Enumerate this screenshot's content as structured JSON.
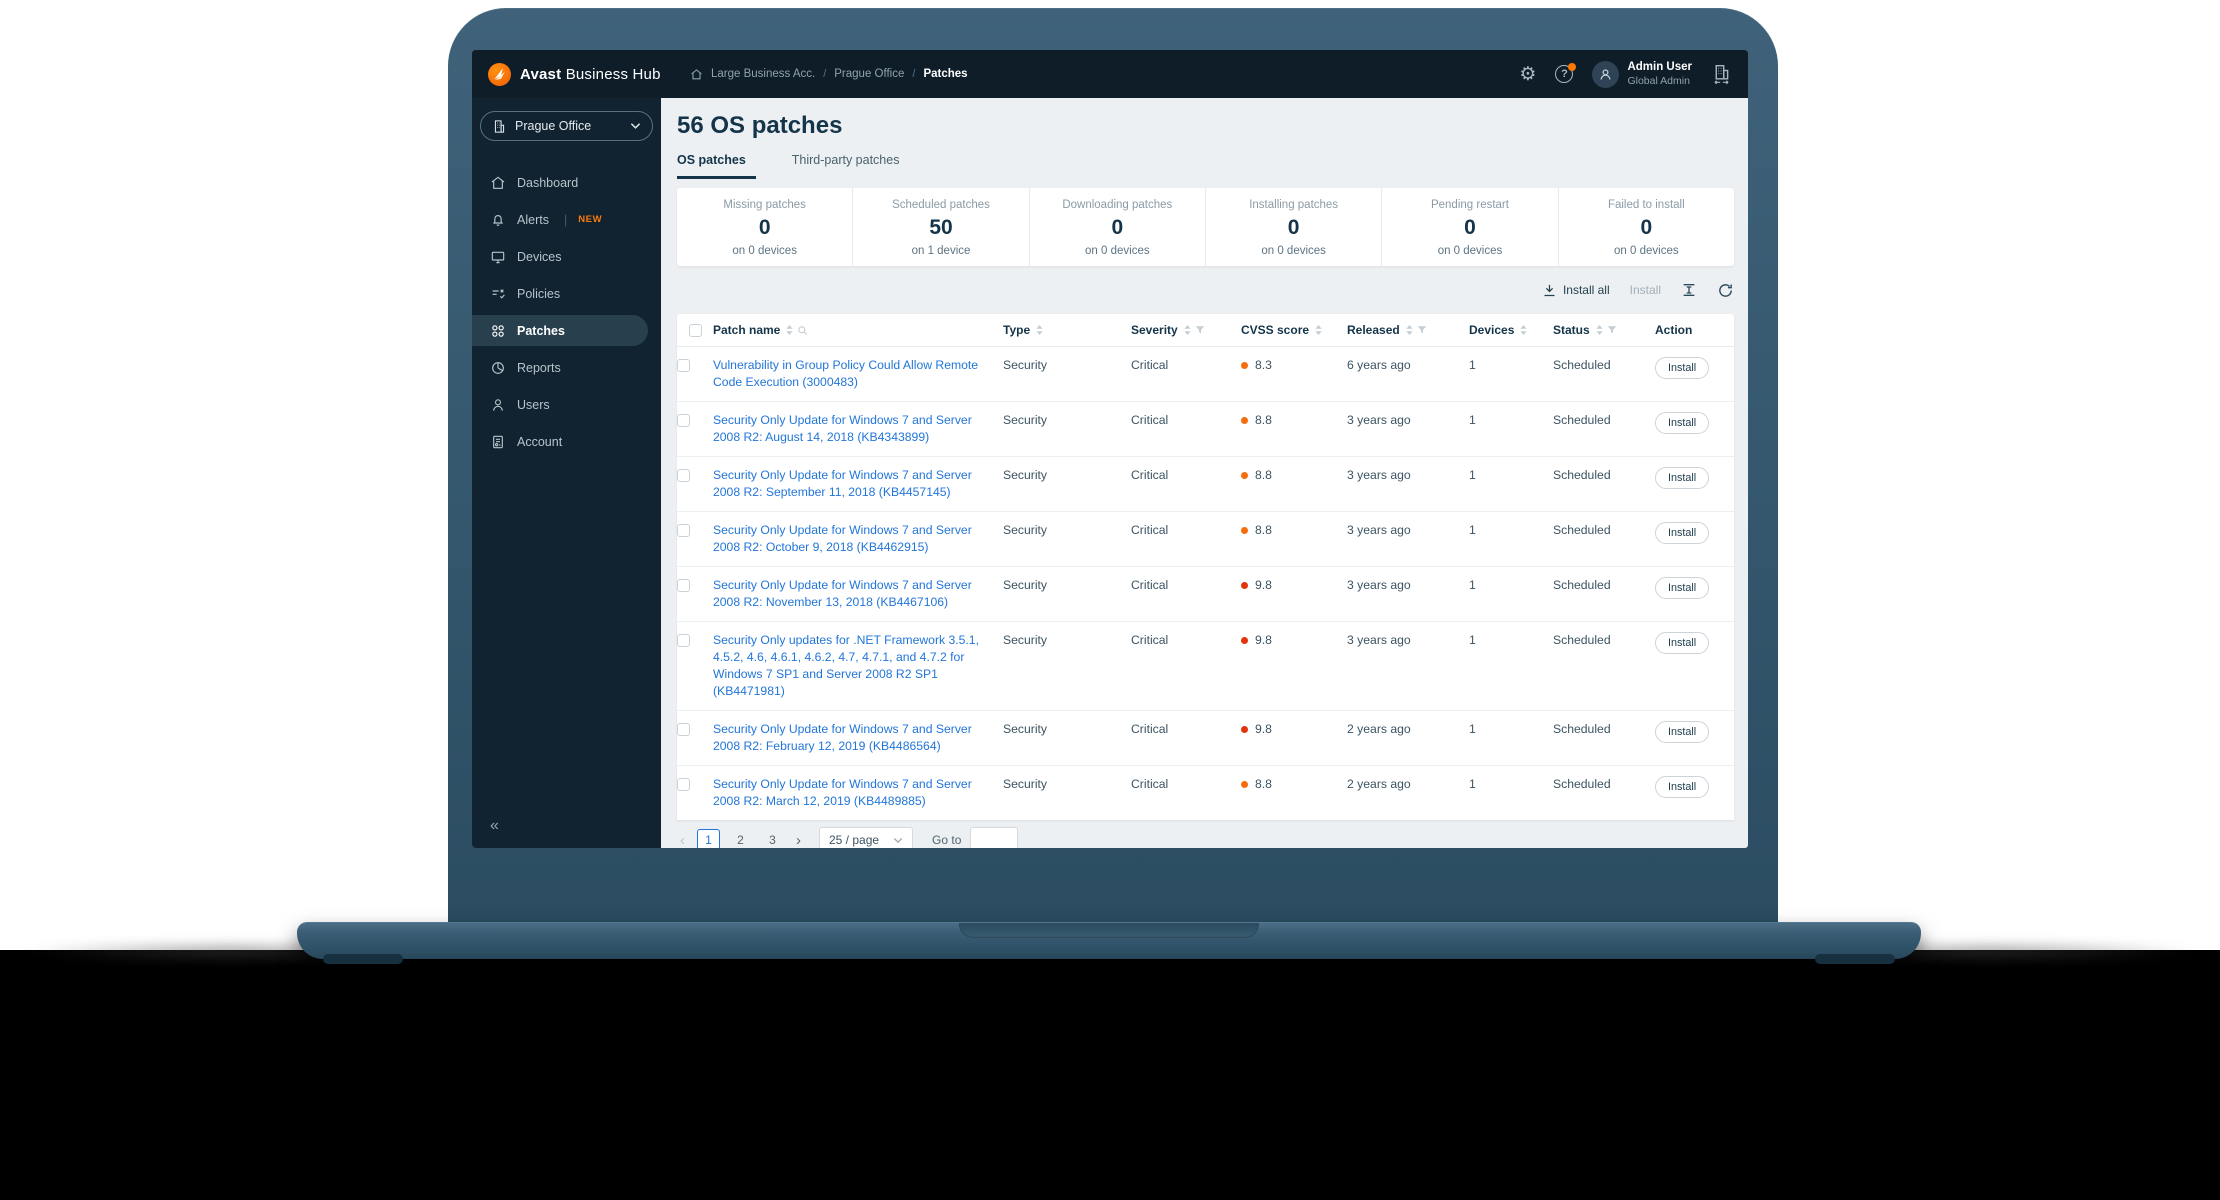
{
  "topbar": {
    "brand_bold": "Avast",
    "brand_rest": "Business Hub",
    "breadcrumb": [
      "Large Business Acc.",
      "Prague Office",
      "Patches"
    ],
    "user": {
      "name": "Admin User",
      "role": "Global Admin"
    }
  },
  "sidebar": {
    "org_selector": "Prague Office",
    "items": [
      {
        "label": "Dashboard"
      },
      {
        "label": "Alerts",
        "badge": "NEW"
      },
      {
        "label": "Devices"
      },
      {
        "label": "Policies"
      },
      {
        "label": "Patches",
        "active": true
      },
      {
        "label": "Reports"
      },
      {
        "label": "Users"
      },
      {
        "label": "Account"
      }
    ]
  },
  "icons": {
    "gear": "⚙",
    "help": "?",
    "collapse": "«",
    "prev": "‹",
    "next": "›"
  },
  "main": {
    "title": "56 OS patches",
    "tabs": [
      {
        "label": "OS patches",
        "active": true
      },
      {
        "label": "Third-party patches",
        "active": false
      }
    ],
    "stats": [
      {
        "label": "Missing patches",
        "value": "0",
        "sub": "on 0 devices"
      },
      {
        "label": "Scheduled patches",
        "value": "50",
        "sub": "on 1 device"
      },
      {
        "label": "Downloading patches",
        "value": "0",
        "sub": "on 0 devices"
      },
      {
        "label": "Installing patches",
        "value": "0",
        "sub": "on 0 devices"
      },
      {
        "label": "Pending restart",
        "value": "0",
        "sub": "on 0 devices"
      },
      {
        "label": "Failed to install",
        "value": "0",
        "sub": "on 0 devices"
      }
    ],
    "toolbar": {
      "install_all": "Install all",
      "install": "Install"
    },
    "table": {
      "columns": [
        {
          "label": "Patch name"
        },
        {
          "label": "Type"
        },
        {
          "label": "Severity"
        },
        {
          "label": "CVSS score"
        },
        {
          "label": "Released"
        },
        {
          "label": "Devices"
        },
        {
          "label": "Status"
        },
        {
          "label": "Action"
        }
      ],
      "rows": [
        {
          "name": "Vulnerability in Group Policy Could Allow Remote Code Execution (3000483)",
          "type": "Security",
          "severity": "Critical",
          "cvss": "8.3",
          "cvss_color": "#f66e0c",
          "released": "6 years ago",
          "devices": "1",
          "status": "Scheduled",
          "action": "Install"
        },
        {
          "name": "Security Only Update for Windows 7 and Server 2008 R2: August 14, 2018 (KB4343899)",
          "type": "Security",
          "severity": "Critical",
          "cvss": "8.8",
          "cvss_color": "#f66e0c",
          "released": "3 years ago",
          "devices": "1",
          "status": "Scheduled",
          "action": "Install"
        },
        {
          "name": "Security Only Update for Windows 7 and Server 2008 R2: September 11, 2018 (KB4457145)",
          "type": "Security",
          "severity": "Critical",
          "cvss": "8.8",
          "cvss_color": "#f66e0c",
          "released": "3 years ago",
          "devices": "1",
          "status": "Scheduled",
          "action": "Install"
        },
        {
          "name": "Security Only Update for Windows 7 and Server 2008 R2: October 9, 2018 (KB4462915)",
          "type": "Security",
          "severity": "Critical",
          "cvss": "8.8",
          "cvss_color": "#f66e0c",
          "released": "3 years ago",
          "devices": "1",
          "status": "Scheduled",
          "action": "Install"
        },
        {
          "name": "Security Only Update for Windows 7 and Server 2008 R2: November 13, 2018 (KB4467106)",
          "type": "Security",
          "severity": "Critical",
          "cvss": "9.8",
          "cvss_color": "#e1340c",
          "released": "3 years ago",
          "devices": "1",
          "status": "Scheduled",
          "action": "Install"
        },
        {
          "name": "Security Only updates for .NET Framework 3.5.1, 4.5.2, 4.6, 4.6.1, 4.6.2, 4.7, 4.7.1, and 4.7.2 for Windows 7 SP1 and Server 2008 R2 SP1 (KB4471981)",
          "type": "Security",
          "severity": "Critical",
          "cvss": "9.8",
          "cvss_color": "#e1340c",
          "released": "3 years ago",
          "devices": "1",
          "status": "Scheduled",
          "action": "Install"
        },
        {
          "name": "Security Only Update for Windows 7 and Server 2008 R2: February 12, 2019 (KB4486564)",
          "type": "Security",
          "severity": "Critical",
          "cvss": "9.8",
          "cvss_color": "#e1340c",
          "released": "2 years ago",
          "devices": "1",
          "status": "Scheduled",
          "action": "Install"
        },
        {
          "name": "Security Only Update for Windows 7 and Server 2008 R2: March 12, 2019 (KB4489885)",
          "type": "Security",
          "severity": "Critical",
          "cvss": "8.8",
          "cvss_color": "#f66e0c",
          "released": "2 years ago",
          "devices": "1",
          "status": "Scheduled",
          "action": "Install"
        }
      ]
    },
    "pagination": {
      "pages": [
        "1",
        "2",
        "3"
      ],
      "active_page": "1",
      "page_size": "25 / page",
      "goto_label": "Go to"
    }
  },
  "colors": {
    "accent_orange": "#ff7800",
    "severity_high": "#e1340c",
    "severity_medium": "#f66e0c",
    "link_blue": "#2276d9"
  }
}
